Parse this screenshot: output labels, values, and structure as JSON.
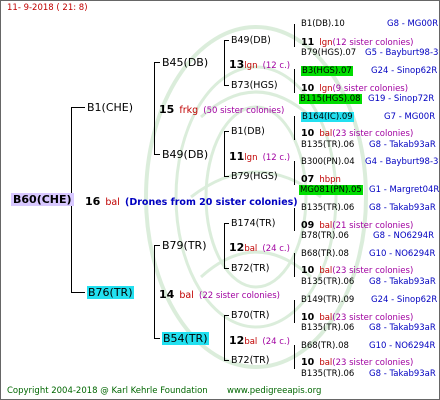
{
  "header": {
    "date": "11-  9-2018 (  21:  8)"
  },
  "footer": {
    "copyright": "Copyright 2004-2018 @ Karl Kehrle Foundation",
    "site": "www.pedigreeapis.org"
  },
  "root": {
    "label": "B60(CHE)",
    "count": "16",
    "race": "bal",
    "note": "(Drones from 20 sister colonies)"
  },
  "g1": [
    {
      "label": "B1(CHE)",
      "count": "15",
      "race": "frkg",
      "note": "(50 sister colonies)"
    },
    {
      "label": "B76(TR)",
      "count": "14",
      "race": "bal",
      "note": "(22 sister colonies)"
    }
  ],
  "g2": [
    {
      "label": "B45(DB)",
      "count": "13",
      "race": "lgn",
      "note": "(12 c.)"
    },
    {
      "label": "B49(DB)",
      "count": "11",
      "race": "lgn",
      "note": "(12 c.)"
    },
    {
      "label": "B79(TR)",
      "count": "12",
      "race": "bal",
      "note": "(24 c.)"
    },
    {
      "label": "B54(TR)",
      "count": "12",
      "race": "bal",
      "note": "(24 c.)"
    }
  ],
  "g3": [
    {
      "label": "B49(DB)",
      "count": "11",
      "race": "lgn",
      "note": "(12 sister colonies)"
    },
    {
      "label": "B73(HGS)",
      "count": "10",
      "race": "lgn",
      "note": "(9 sister colonies)"
    },
    {
      "label": "B1(DB)",
      "count": "10",
      "race": "bal",
      "note": "(23 sister colonies)"
    },
    {
      "label": "B79(HGS)",
      "count": "07",
      "race": "hbpn",
      "note": ""
    },
    {
      "label": "B174(TR)",
      "count": "09",
      "race": "bal",
      "note": "(21 sister colonies)"
    },
    {
      "label": "B72(TR)",
      "count": "10",
      "race": "bal",
      "note": "(23 sister colonies)"
    },
    {
      "label": "B70(TR)",
      "count": "10",
      "race": "bal",
      "note": "(23 sister colonies)"
    },
    {
      "label": "B72(TR)",
      "count": "10",
      "race": "bal",
      "note": "(23 sister colonies)"
    }
  ],
  "g4": [
    {
      "label": "B1(DB).10",
      "right": "G8 - MG00R"
    },
    {
      "label": "B79(HGS).07",
      "right": "G5 - Bayburt98-3"
    },
    {
      "label": "B3(HGS).07",
      "right": "G24 - Sinop62R"
    },
    {
      "label": "B115(HGS).08",
      "right": "G19 - Sinop72R"
    },
    {
      "label": "B164(IC).09",
      "right": "G7 - MG00R"
    },
    {
      "label": "B135(TR).06",
      "right": "G8 - Takab93aR"
    },
    {
      "label": "B300(PN).04",
      "right": "G4 - Bayburt98-3"
    },
    {
      "label": "MG081(PN).05",
      "right": "G1 - Margret04R"
    },
    {
      "label": "B135(TR).06",
      "right": "G8 - Takab93aR"
    },
    {
      "label": "B78(TR).06",
      "right": "G8 - NO6294R"
    },
    {
      "label": "B68(TR).08",
      "right": "G10 - NO6294R"
    },
    {
      "label": "B135(TR).06",
      "right": "G8 - Takab93aR"
    },
    {
      "label": "B149(TR).09",
      "right": "G24 - Sinop62R"
    },
    {
      "label": "B135(TR).06",
      "right": "G8 - Takab93aR"
    },
    {
      "label": "B68(TR).08",
      "right": "G10 - NO6294R"
    },
    {
      "label": "B135(TR).06",
      "right": "G8 - Takab93aR"
    }
  ],
  "colors": {
    "green_highlight": "#00dd00",
    "cyan_highlight": "#22e0f0",
    "root_highlight": "#d8c8ff",
    "link_blue": "#0000c0",
    "race_red": "#c00000"
  }
}
